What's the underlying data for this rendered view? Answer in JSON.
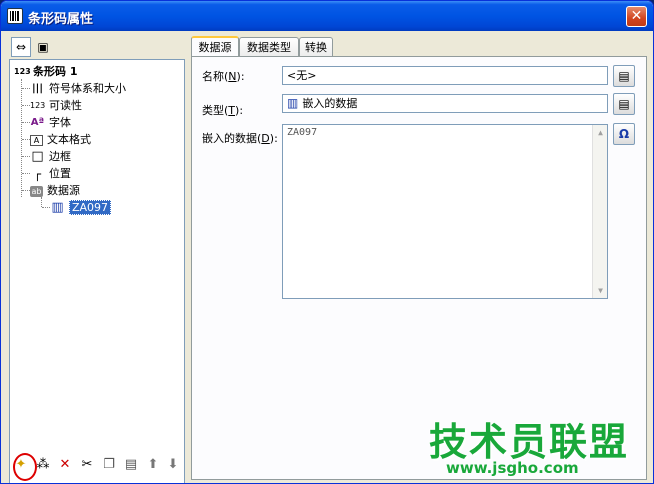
{
  "window": {
    "title": "条形码属性",
    "close_label": "✕"
  },
  "left_toolbar": {
    "icons": [
      "collapse-icon",
      "layers-icon"
    ]
  },
  "tree": {
    "root": {
      "label": "条形码 1",
      "icon_text": "123"
    },
    "items": [
      {
        "label": "符号体系和大小",
        "icon_text": "|||"
      },
      {
        "label": "可读性",
        "icon_text": "123"
      },
      {
        "label": "字体",
        "icon_text": "Aª"
      },
      {
        "label": "文本格式",
        "icon_text": "A"
      },
      {
        "label": "边框",
        "icon_text": "□"
      },
      {
        "label": "位置",
        "icon_text": "┌"
      },
      {
        "label": "数据源",
        "icon_text": "ab"
      }
    ],
    "child": {
      "label": "ZA097",
      "icon_text": "▥"
    }
  },
  "bottom_toolbar": {
    "icons": [
      {
        "name": "new-icon",
        "glyph": "✦"
      },
      {
        "name": "wand-icon",
        "glyph": "⁂"
      },
      {
        "name": "delete-icon",
        "glyph": "✕"
      },
      {
        "name": "cut-icon",
        "glyph": "✂"
      },
      {
        "name": "copy-icon",
        "glyph": "❐"
      },
      {
        "name": "paste-icon",
        "glyph": "▤"
      },
      {
        "name": "move-up-icon",
        "glyph": "⬆"
      },
      {
        "name": "move-down-icon",
        "glyph": "⬇"
      }
    ]
  },
  "tabs": [
    {
      "label": "数据源",
      "active": true
    },
    {
      "label": "数据类型",
      "active": false
    },
    {
      "label": "转换",
      "active": false
    }
  ],
  "form": {
    "name_label": "名称",
    "name_key": "N",
    "name_value": "<无>",
    "type_label": "类型",
    "type_key": "T",
    "type_value": "嵌入的数据",
    "data_label": "嵌入的数据",
    "data_key": "D",
    "data_value": "ZA097",
    "omega_glyph": "Ω"
  },
  "watermark": {
    "main": "技术员联盟",
    "url": "www.jsgho.com"
  },
  "colors": {
    "title_bar": "#0054e3",
    "selection": "#316ac5",
    "watermark": "#19a83a",
    "highlight_circle": "#dd0000"
  }
}
